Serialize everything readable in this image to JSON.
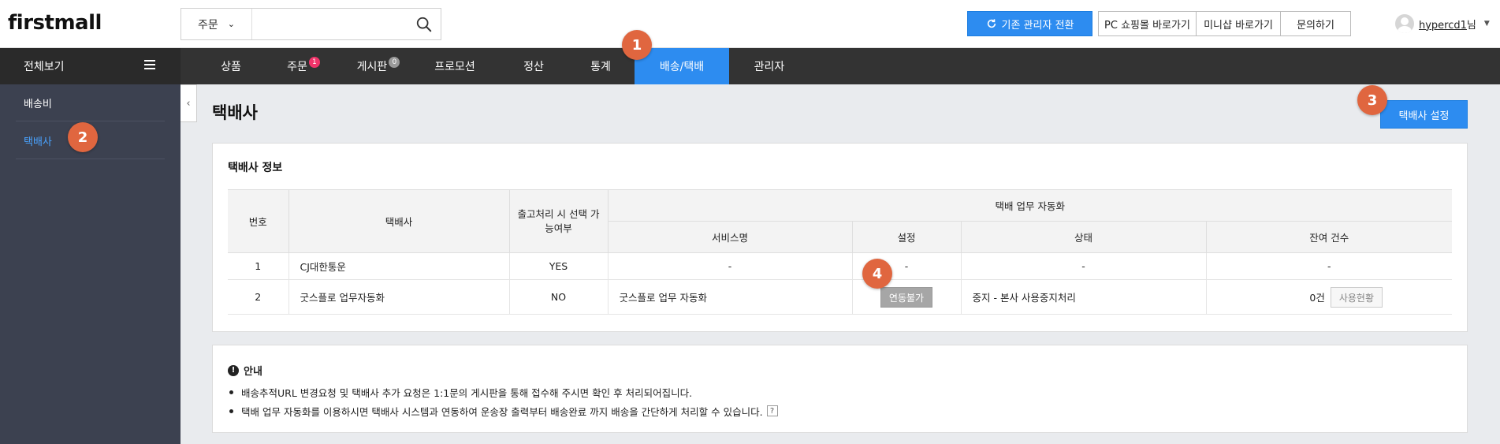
{
  "header": {
    "logo": "firstmall",
    "search": {
      "category": "주문",
      "value": "",
      "placeholder": ""
    },
    "switch_admin_label": "기존 관리자 전환",
    "links": [
      "PC 쇼핑몰 바로가기",
      "미니샵 바로가기",
      "문의하기"
    ],
    "user_name": "hypercd1",
    "user_suffix": "님"
  },
  "nav": {
    "all_label": "전체보기",
    "items": [
      {
        "label": "상품",
        "badge": ""
      },
      {
        "label": "주문",
        "badge": "1"
      },
      {
        "label": "게시판",
        "badge": "0"
      },
      {
        "label": "프로모션",
        "badge": ""
      },
      {
        "label": "정산",
        "badge": ""
      },
      {
        "label": "통계",
        "badge": ""
      },
      {
        "label": "배송/택배",
        "badge": ""
      },
      {
        "label": "관리자",
        "badge": ""
      }
    ],
    "active": "배송/택배"
  },
  "sidebar": {
    "items": [
      {
        "label": "배송비"
      },
      {
        "label": "택배사"
      }
    ],
    "active": "택배사"
  },
  "main": {
    "title": "택배사",
    "setting_button": "택배사 설정",
    "info_title": "택배사 정보",
    "table": {
      "headers": {
        "no": "번호",
        "courier": "택배사",
        "selectable": "출고처리 시 선택 가능여부",
        "automation": "택배 업무 자동화",
        "service": "서비스명",
        "setting": "설정",
        "status": "상태",
        "remaining": "잔여 건수"
      },
      "rows": [
        {
          "no": "1",
          "courier": "CJ대한통운",
          "selectable": "YES",
          "service": "-",
          "setting": "-",
          "status": "-",
          "remaining": "-",
          "usage_button": ""
        },
        {
          "no": "2",
          "courier": "굿스플로 업무자동화",
          "selectable": "NO",
          "service": "굿스플로 업무 자동화",
          "setting": "연동불가",
          "status": "중지 - 본사 사용중지처리",
          "remaining": "0건",
          "usage_button": "사용현황"
        }
      ]
    },
    "guide": {
      "title": "안내",
      "items": [
        "배송추적URL 변경요청 및 택배사 추가 요청은 1:1문의 게시판을 통해 접수해 주시면 확인 후 처리되어집니다.",
        "택배 업무 자동화를 이용하시면 택배사 시스템과 연동하여 운송장 출력부터 배송완료 까지 배송을 간단하게 처리할 수 있습니다."
      ],
      "help_icon": "?"
    }
  },
  "markers": [
    "1",
    "2",
    "3",
    "4"
  ],
  "colors": {
    "accent": "#2d8cf0",
    "marker": "#e0663f",
    "badge_red": "#f0346a",
    "sidebar_bg": "#3c4150",
    "nav_bg": "#333333"
  }
}
